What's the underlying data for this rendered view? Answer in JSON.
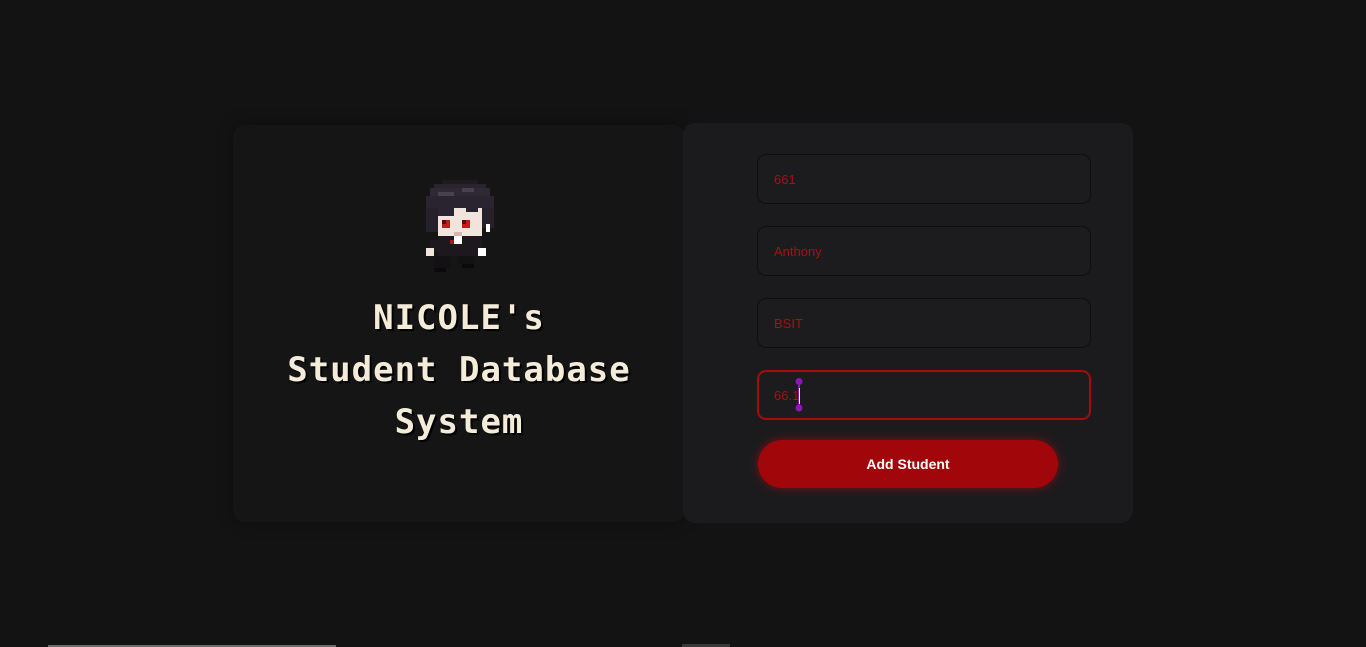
{
  "title": {
    "line1": "NICOLE's",
    "line2": "Student Database",
    "line3": "System"
  },
  "form": {
    "fields": [
      {
        "value": "661"
      },
      {
        "value": "Anthony"
      },
      {
        "value": "BSIT"
      },
      {
        "value": "66.1"
      }
    ],
    "submit_label": "Add Student"
  },
  "icons": {
    "avatar": "pixel-character-avatar-icon",
    "cursor": "text-cursor-icon"
  },
  "colors": {
    "accent": "#a1070a",
    "field_text": "#a31313",
    "title_text": "#f4ecd9",
    "background": "#131314",
    "card": "#1b1b1d",
    "cursor": "#8a17b8"
  }
}
